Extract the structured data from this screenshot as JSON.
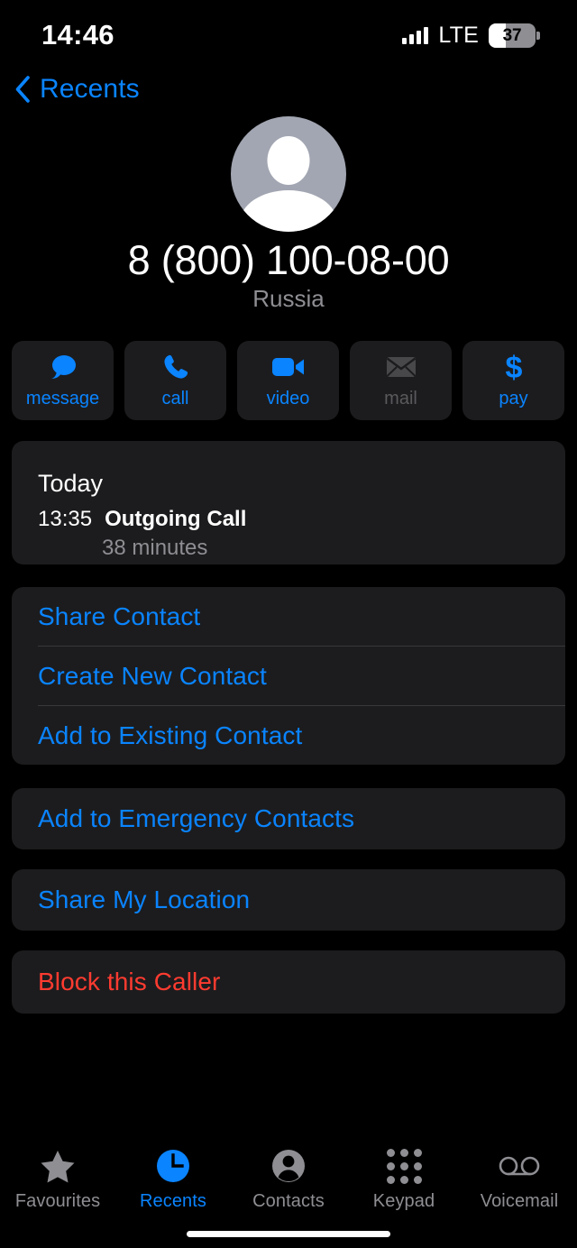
{
  "status_bar": {
    "time": "14:46",
    "network": "LTE",
    "battery_level": "37",
    "signal_icon": "signal-bars-icon",
    "battery_icon": "battery-icon"
  },
  "nav": {
    "back_label": "Recents",
    "back_icon": "chevron-left-icon"
  },
  "contact": {
    "avatar_icon": "person-placeholder-avatar",
    "phone_number": "8 (800) 100-08-00",
    "country": "Russia"
  },
  "quick_actions": [
    {
      "label": "message",
      "icon": "message-bubble-icon",
      "enabled": true
    },
    {
      "label": "call",
      "icon": "phone-handset-icon",
      "enabled": true
    },
    {
      "label": "video",
      "icon": "video-camera-icon",
      "enabled": true
    },
    {
      "label": "mail",
      "icon": "envelope-icon",
      "enabled": false
    },
    {
      "label": "pay",
      "icon": "dollar-sign-icon",
      "enabled": true
    }
  ],
  "call_history": {
    "day_label": "Today",
    "time": "13:35",
    "type": "Outgoing Call",
    "duration": "38 minutes"
  },
  "contact_actions": [
    {
      "label": "Share Contact",
      "style": "blue"
    },
    {
      "label": "Create New Contact",
      "style": "blue"
    },
    {
      "label": "Add to Existing Contact",
      "style": "blue"
    }
  ],
  "emergency_action": {
    "label": "Add to Emergency Contacts",
    "style": "blue"
  },
  "location_action": {
    "label": "Share My Location",
    "style": "blue"
  },
  "block_action": {
    "label": "Block this Caller",
    "style": "red"
  },
  "tabs": [
    {
      "label": "Favourites",
      "icon": "star-icon",
      "active": false
    },
    {
      "label": "Recents",
      "icon": "clock-icon",
      "active": true
    },
    {
      "label": "Contacts",
      "icon": "person-circle-icon",
      "active": false
    },
    {
      "label": "Keypad",
      "icon": "keypad-grid-icon",
      "active": false
    },
    {
      "label": "Voicemail",
      "icon": "voicemail-tape-icon",
      "active": false
    }
  ],
  "colors": {
    "accent_blue": "#0a84ff",
    "danger_red": "#ff3b30",
    "card_bg": "#1c1c1e",
    "secondary_text": "#8e8e93",
    "background": "#000000"
  }
}
